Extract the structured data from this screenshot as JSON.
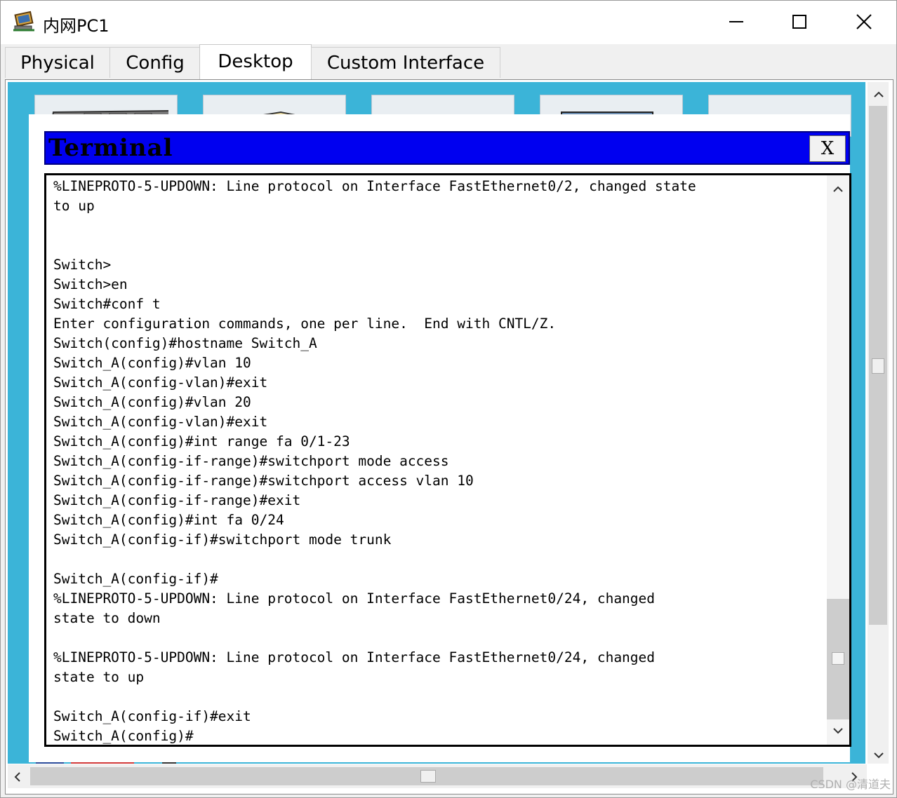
{
  "window": {
    "title": "内网PC1",
    "icon": "packet-tracer-pc-icon"
  },
  "tabs": [
    {
      "label": "Physical",
      "active": false
    },
    {
      "label": "Config",
      "active": false
    },
    {
      "label": "Desktop",
      "active": true
    },
    {
      "label": "Custom Interface",
      "active": false
    }
  ],
  "terminal": {
    "title": "Terminal",
    "close_label": "X",
    "lines": [
      "%LINEPROTO-5-UPDOWN: Line protocol on Interface FastEthernet0/2, changed state",
      "to up",
      "",
      "",
      "Switch>",
      "Switch>en",
      "Switch#conf t",
      "Enter configuration commands, one per line.  End with CNTL/Z.",
      "Switch(config)#hostname Switch_A",
      "Switch_A(config)#vlan 10",
      "Switch_A(config-vlan)#exit",
      "Switch_A(config)#vlan 20",
      "Switch_A(config-vlan)#exit",
      "Switch_A(config)#int range fa 0/1-23",
      "Switch_A(config-if-range)#switchport mode access",
      "Switch_A(config-if-range)#switchport access vlan 10",
      "Switch_A(config-if-range)#exit",
      "Switch_A(config)#int fa 0/24",
      "Switch_A(config-if)#switchport mode trunk",
      "",
      "Switch_A(config-if)#",
      "%LINEPROTO-5-UPDOWN: Line protocol on Interface FastEthernet0/24, changed",
      "state to down",
      "",
      "%LINEPROTO-5-UPDOWN: Line protocol on Interface FastEthernet0/24, changed",
      "state to up",
      "",
      "Switch_A(config-if)#exit",
      "Switch_A(config)#"
    ]
  },
  "watermark": "CSDN @清道夫"
}
